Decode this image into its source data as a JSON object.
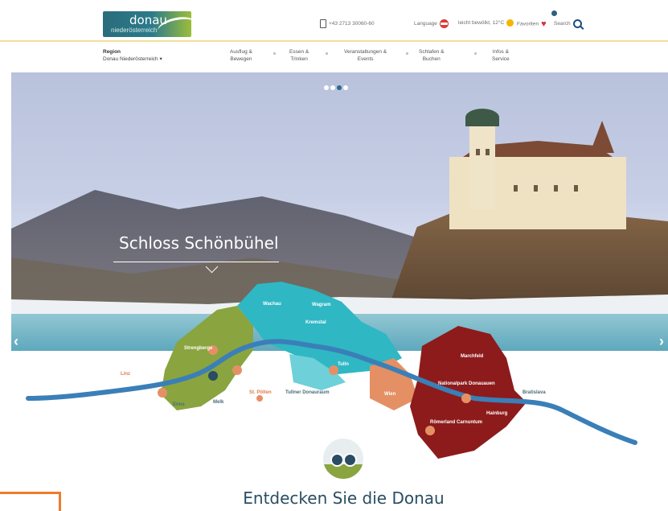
{
  "header": {
    "logo_line1": "donau",
    "logo_line2": "niederösterreich",
    "phone": "+43 2713 30060-60",
    "language_label": "Language",
    "weather": "leicht bewölkt, 12°C",
    "favorites_label": "Favoriten",
    "search_label": "Search"
  },
  "nav": {
    "region_label": "Region",
    "region_value": "Donau Niederösterreich",
    "items": [
      {
        "l1": "Ausflug &",
        "l2": "Bewegen"
      },
      {
        "l1": "Essen &",
        "l2": "Trinken"
      },
      {
        "l1": "Veranstaltungen &",
        "l2": "Events"
      },
      {
        "l1": "Schlafen &",
        "l2": "Buchen"
      },
      {
        "l1": "Infos &",
        "l2": "Service"
      }
    ]
  },
  "hero": {
    "caption": "Schloss Schönbühel",
    "slides_total": 4,
    "active_slide": 3
  },
  "map": {
    "labels": {
      "linz": "Linz",
      "enns": "Enns",
      "melk": "Melk",
      "strengberg": "Strengberge",
      "nibelungengau": "Nibelungengau",
      "wachau": "Wachau",
      "wachau_region": "Wachau",
      "krems": "Krems",
      "tulln": "Tulln",
      "tullner": "Tullner Donauraum",
      "stpoelten": "St. Pölten",
      "wien": "Wien",
      "marchfeld": "Marchfeld",
      "nationalpark": "Nationalpark Donauauen",
      "roemerland": "Römerland Carnuntum",
      "hainburg": "Hainburg",
      "bratislava": "Bratislava",
      "waldviertel": "Kremstal",
      "weinviertel": "Wagram"
    }
  },
  "section": {
    "headline": "Entdecken Sie die Donau"
  },
  "colors": {
    "brand_blue": "#2a4d63",
    "accent_green": "#8aa440",
    "accent_orange": "#ef7c2a",
    "region_red": "#8d1b1b",
    "region_teal": "#2fb7c4"
  }
}
